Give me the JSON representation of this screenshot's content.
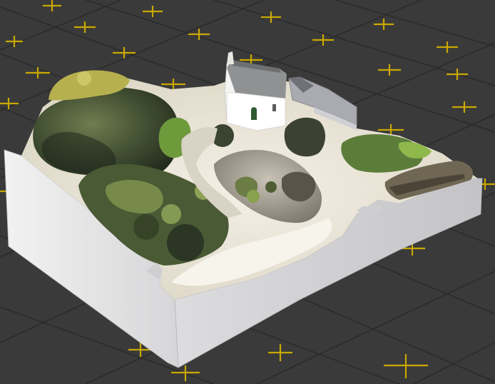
{
  "viewer": {
    "background_color": "#3a3a3a",
    "grid_color": "#2c2c2c",
    "axis_marker_color": "#c9a800",
    "model_base_color": "#e9e9ea",
    "model_description_hidden": ""
  },
  "model": {
    "type": "photogrammetry-terrain-tile",
    "features": [
      "chapel",
      "rocks",
      "vegetation",
      "path",
      "stone-wall",
      "neighbouring-building"
    ]
  }
}
